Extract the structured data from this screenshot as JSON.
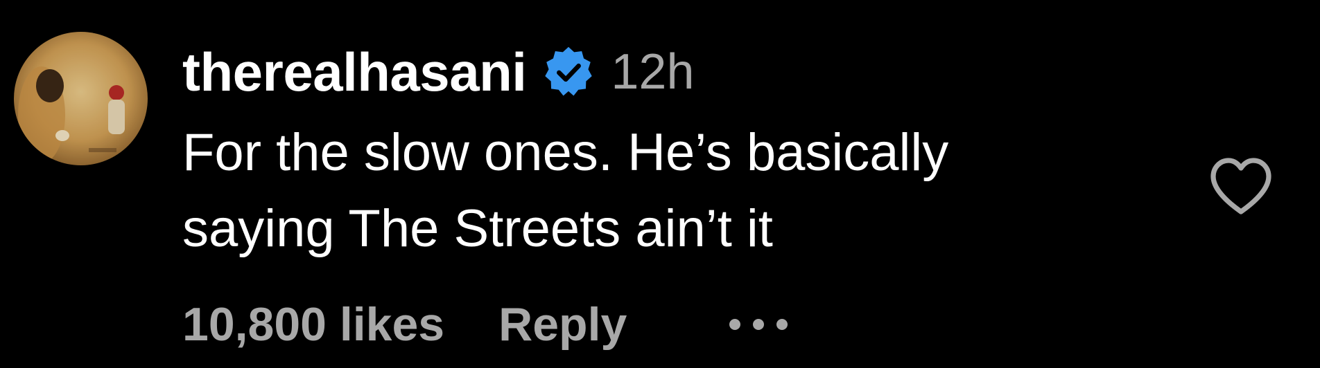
{
  "comment": {
    "username": "therealhasani",
    "verified": true,
    "timestamp": "12h",
    "text_line_1": "For the slow ones. He’s basically",
    "text_line_2": "saying The Streets ain’t it",
    "likes": "10,800 likes",
    "reply_label": "Reply",
    "more_icon": "more-options-icon",
    "like_icon": "heart-outline-icon",
    "verified_icon": "verified-badge-icon"
  },
  "colors": {
    "background": "#000000",
    "primary_text": "#ffffff",
    "secondary_text": "#a8a8a8",
    "verified_blue": "#3897f0"
  }
}
